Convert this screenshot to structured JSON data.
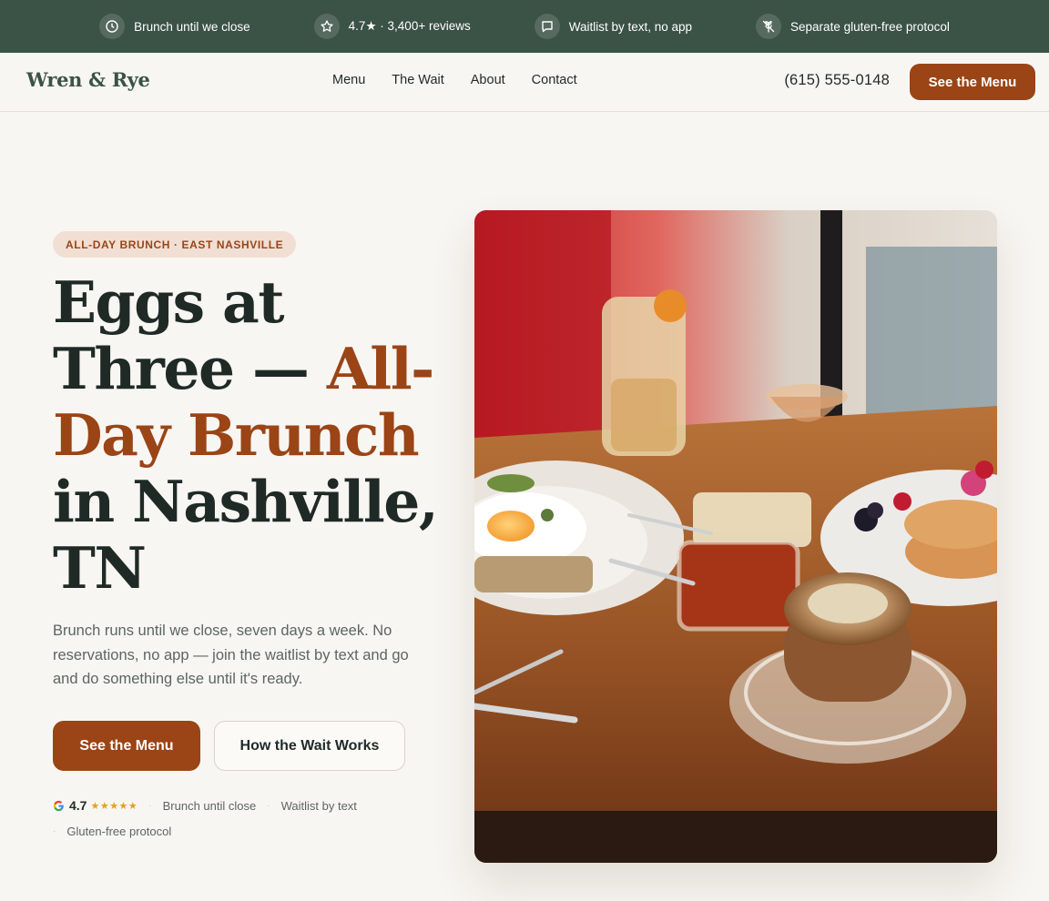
{
  "topbar": {
    "items": [
      {
        "icon": "clock-icon",
        "text": "Brunch until we close"
      },
      {
        "icon": "star-icon",
        "text": "4.7★ · 3,400+ reviews"
      },
      {
        "icon": "message-icon",
        "text": "Waitlist by text, no app"
      },
      {
        "icon": "wheat-off-icon",
        "text": "Separate gluten-free protocol"
      }
    ]
  },
  "header": {
    "logo": "Wren & Rye",
    "nav": [
      "Menu",
      "The Wait",
      "About",
      "Contact"
    ],
    "phone": "(615) 555-0148",
    "cta": "See the Menu"
  },
  "hero": {
    "eyebrow": "ALL-DAY BRUNCH · EAST NASHVILLE",
    "headline_part1": "Eggs at Three — ",
    "headline_accent": "All-Day Brunch",
    "headline_part2": " in Nashville, TN",
    "subhead": "Brunch runs until we close, seven days a week. No reservations, no app — join the waitlist by text and go and do something else until it's ready.",
    "primary_cta": "See the Menu",
    "secondary_cta": "How the Wait Works",
    "trust": {
      "rating": "4.7",
      "stars": "★★★★★",
      "items": [
        "Brunch until close",
        "Waitlist by text",
        "Gluten-free protocol"
      ]
    }
  },
  "colors": {
    "topbar_bg": "#3b5246",
    "accent": "#9b4416",
    "text": "#1f2a27",
    "background": "#f8f6f2",
    "star": "#e7a11b"
  }
}
